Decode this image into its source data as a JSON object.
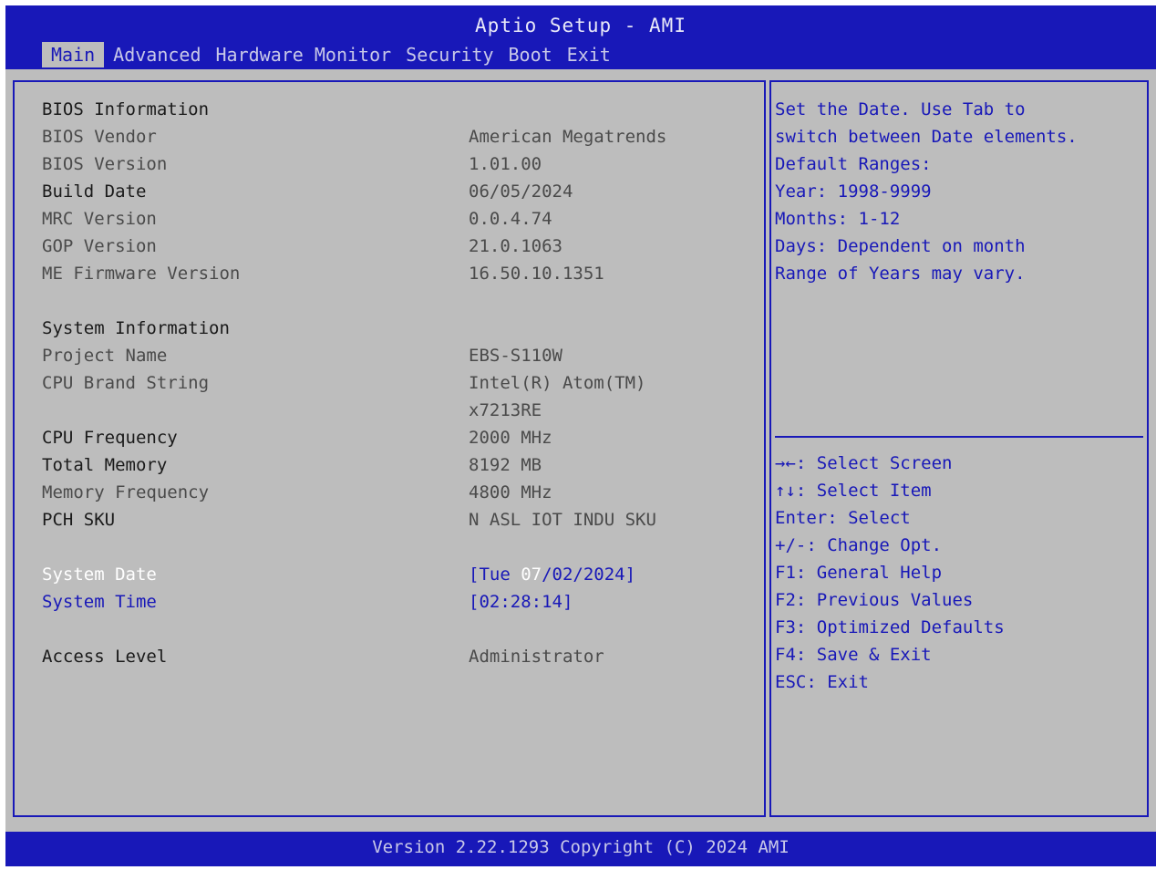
{
  "header": {
    "title": "Aptio Setup - AMI",
    "tabs": [
      "Main",
      "Advanced",
      "Hardware Monitor",
      "Security",
      "Boot",
      "Exit"
    ],
    "active_tab": "Main"
  },
  "main": {
    "bios_info_heading": "BIOS Information",
    "bios_vendor_label": "BIOS Vendor",
    "bios_vendor_value": "American Megatrends",
    "bios_version_label": "BIOS Version",
    "bios_version_value": "1.01.00",
    "build_date_label": "Build Date",
    "build_date_value": "06/05/2024",
    "mrc_version_label": "MRC Version",
    "mrc_version_value": "0.0.4.74",
    "gop_version_label": "GOP Version",
    "gop_version_value": "21.0.1063",
    "me_fw_label": "ME Firmware Version",
    "me_fw_value": "16.50.10.1351",
    "system_info_heading": "System Information",
    "project_name_label": "Project Name",
    "project_name_value": "EBS-S110W",
    "cpu_brand_label": "CPU Brand String",
    "cpu_brand_value_1": "Intel(R) Atom(TM)",
    "cpu_brand_value_2": "x7213RE",
    "cpu_freq_label": "CPU Frequency",
    "cpu_freq_value": "2000 MHz",
    "total_memory_label": "Total Memory",
    "total_memory_value": "8192 MB",
    "memory_freq_label": "Memory Frequency",
    "memory_freq_value": "4800 MHz",
    "pch_sku_label": "PCH SKU",
    "pch_sku_value": "N ASL IOT INDU SKU",
    "system_date_label": "System Date",
    "system_date_prefix": "[Tue ",
    "system_date_month": "07",
    "system_date_suffix": "/02/2024]",
    "system_time_label": "System Time",
    "system_time_value": "[02:28:14]",
    "access_level_label": "Access Level",
    "access_level_value": "Administrator"
  },
  "help": {
    "lines": [
      "Set the Date. Use Tab to",
      "switch between Date elements.",
      "Default Ranges:",
      "Year: 1998-9999",
      "Months: 1-12",
      "Days: Dependent on month",
      "Range of Years may vary."
    ],
    "keys": [
      "→←: Select Screen",
      "↑↓: Select Item",
      "Enter: Select",
      "+/-: Change Opt.",
      "F1: General Help",
      "F2: Previous Values",
      "F3: Optimized Defaults",
      "F4: Save & Exit",
      "ESC: Exit"
    ]
  },
  "footer": {
    "text": "Version 2.22.1293 Copyright (C) 2024 AMI"
  },
  "colors": {
    "header_bg": "#1818b8",
    "panel_bg": "#bdbdbd",
    "highlight": "#ffffff",
    "link_blue": "#1818b8"
  }
}
